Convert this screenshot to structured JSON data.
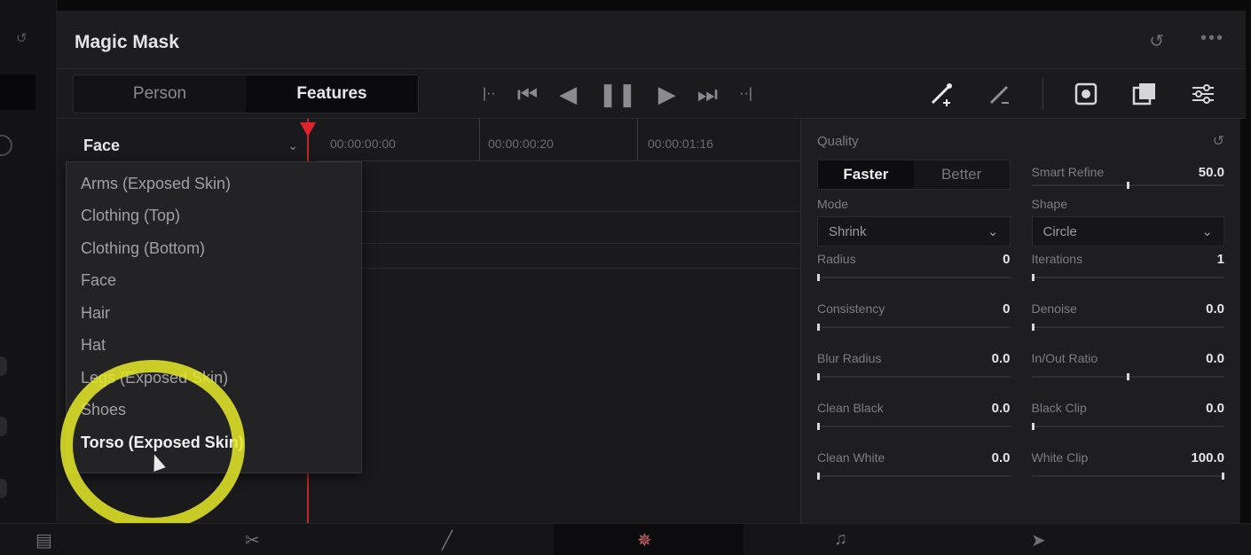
{
  "header": {
    "title": "Magic Mask",
    "reset_icon": "reset-icon",
    "more_icon": "more-options-icon"
  },
  "toolbar": {
    "tabs": [
      {
        "label": "Person",
        "active": false
      },
      {
        "label": "Features",
        "active": true
      }
    ],
    "transport_icons": [
      "track-backward-one-frame-icon",
      "skip-to-start-icon",
      "play-reverse-icon",
      "pause-icon",
      "play-forward-icon",
      "skip-to-end-icon",
      "track-forward-one-frame-icon"
    ],
    "tool_icons": [
      "add-stroke-icon",
      "subtract-stroke-icon",
      "mask-overlay-icon",
      "copy-mask-icon",
      "settings-sliders-icon"
    ]
  },
  "feature_select": {
    "value": "Face"
  },
  "timeline": {
    "timecodes": [
      "00:00:00:00",
      "00:00:00:20",
      "00:00:01:16"
    ]
  },
  "dropdown": {
    "options": [
      "Arms (Exposed Skin)",
      "Clothing (Top)",
      "Clothing (Bottom)",
      "Face",
      "Hair",
      "Hat",
      "Legs (Exposed Skin)",
      "Shoes",
      "Torso (Exposed Skin)"
    ],
    "highlighted_index": 8
  },
  "panel": {
    "quality_label": "Quality",
    "quality_options": [
      {
        "label": "Faster",
        "active": true
      },
      {
        "label": "Better",
        "active": false
      }
    ],
    "smart_refine": {
      "name": "Smart Refine",
      "value": "50.0",
      "level": 0.5
    },
    "mode_label": "Mode",
    "mode_value": "Shrink",
    "shape_label": "Shape",
    "shape_value": "Circle",
    "left_params": [
      {
        "name": "Radius",
        "value": "0",
        "level": 0.0
      },
      {
        "name": "Consistency",
        "value": "0",
        "level": 0.0
      },
      {
        "name": "Blur Radius",
        "value": "0.0",
        "level": 0.0
      },
      {
        "name": "Clean Black",
        "value": "0.0",
        "level": 0.0
      },
      {
        "name": "Clean White",
        "value": "0.0",
        "level": 0.0
      }
    ],
    "right_params": [
      {
        "name": "Iterations",
        "value": "1",
        "level": 0.0
      },
      {
        "name": "Denoise",
        "value": "0.0",
        "level": 0.0
      },
      {
        "name": "In/Out Ratio",
        "value": "0.0",
        "level": 0.5
      },
      {
        "name": "Black Clip",
        "value": "0.0",
        "level": 0.0
      },
      {
        "name": "White Clip",
        "value": "100.0",
        "level": 1.0
      }
    ]
  },
  "bottom_bar": {
    "icons": [
      "media-page-icon",
      "cut-page-icon",
      "edit-page-icon",
      "color-page-icon",
      "fairlight-page-icon",
      "deliver-page-icon"
    ]
  },
  "colors": {
    "playhead": "#e2232a",
    "highlight_ring": "#e8ea28"
  }
}
